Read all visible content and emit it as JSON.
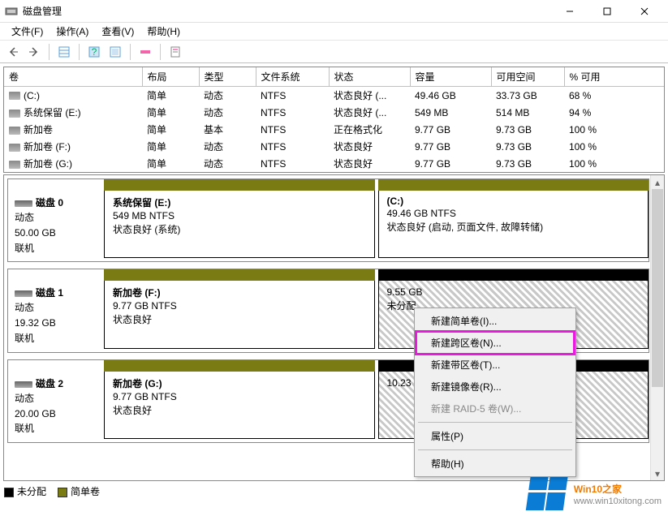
{
  "window": {
    "title": "磁盘管理"
  },
  "menu": {
    "file": "文件(F)",
    "action": "操作(A)",
    "view": "查看(V)",
    "help": "帮助(H)"
  },
  "table": {
    "headers": [
      "卷",
      "布局",
      "类型",
      "文件系统",
      "状态",
      "容量",
      "可用空间",
      "% 可用"
    ],
    "rows": [
      {
        "vol": "(C:)",
        "layout": "简单",
        "type": "动态",
        "fs": "NTFS",
        "status": "状态良好 (...",
        "cap": "49.46 GB",
        "free": "33.73 GB",
        "pct": "68 %"
      },
      {
        "vol": "系统保留 (E:)",
        "layout": "简单",
        "type": "动态",
        "fs": "NTFS",
        "status": "状态良好 (...",
        "cap": "549 MB",
        "free": "514 MB",
        "pct": "94 %"
      },
      {
        "vol": "新加卷",
        "layout": "简单",
        "type": "基本",
        "fs": "NTFS",
        "status": "正在格式化",
        "cap": "9.77 GB",
        "free": "9.73 GB",
        "pct": "100 %"
      },
      {
        "vol": "新加卷 (F:)",
        "layout": "简单",
        "type": "动态",
        "fs": "NTFS",
        "status": "状态良好",
        "cap": "9.77 GB",
        "free": "9.73 GB",
        "pct": "100 %"
      },
      {
        "vol": "新加卷 (G:)",
        "layout": "简单",
        "type": "动态",
        "fs": "NTFS",
        "status": "状态良好",
        "cap": "9.77 GB",
        "free": "9.73 GB",
        "pct": "100 %"
      }
    ]
  },
  "disks": [
    {
      "name": "磁盘 0",
      "dyn": "动态",
      "size": "50.00 GB",
      "state": "联机",
      "parts": [
        {
          "title": "系统保留  (E:)",
          "line2": "549 MB NTFS",
          "line3": "状态良好 (系统)",
          "type": "normal"
        },
        {
          "title": "(C:)",
          "line2": "49.46 GB NTFS",
          "line3": "状态良好 (启动, 页面文件, 故障转储)",
          "type": "normal"
        }
      ]
    },
    {
      "name": "磁盘 1",
      "dyn": "动态",
      "size": "19.32 GB",
      "state": "联机",
      "parts": [
        {
          "title": "新加卷  (F:)",
          "line2": "9.77 GB NTFS",
          "line3": "状态良好",
          "type": "normal"
        },
        {
          "title": "",
          "line2": "9.55 GB",
          "line3": "未分配",
          "type": "unalloc"
        }
      ]
    },
    {
      "name": "磁盘 2",
      "dyn": "动态",
      "size": "20.00 GB",
      "state": "联机",
      "parts": [
        {
          "title": "新加卷  (G:)",
          "line2": "9.77 GB NTFS",
          "line3": "状态良好",
          "type": "normal"
        },
        {
          "title": "",
          "line2": "10.23 GB",
          "line3": "",
          "type": "unalloc"
        }
      ]
    }
  ],
  "context_menu": {
    "items": [
      {
        "label": "新建简单卷(I)...",
        "enabled": true,
        "hl": false
      },
      {
        "label": "新建跨区卷(N)...",
        "enabled": true,
        "hl": true
      },
      {
        "label": "新建带区卷(T)...",
        "enabled": true,
        "hl": false
      },
      {
        "label": "新建镜像卷(R)...",
        "enabled": true,
        "hl": false
      },
      {
        "label": "新建 RAID-5 卷(W)...",
        "enabled": false,
        "hl": false
      },
      {
        "label": "属性(P)",
        "enabled": true,
        "hl": false
      },
      {
        "label": "帮助(H)",
        "enabled": true,
        "hl": false
      }
    ]
  },
  "legend": {
    "unalloc": "未分配",
    "simple": "简单卷"
  },
  "watermark": {
    "brand1": "Win10",
    "brand2": "之家",
    "url": "www.win10xitong.com"
  }
}
